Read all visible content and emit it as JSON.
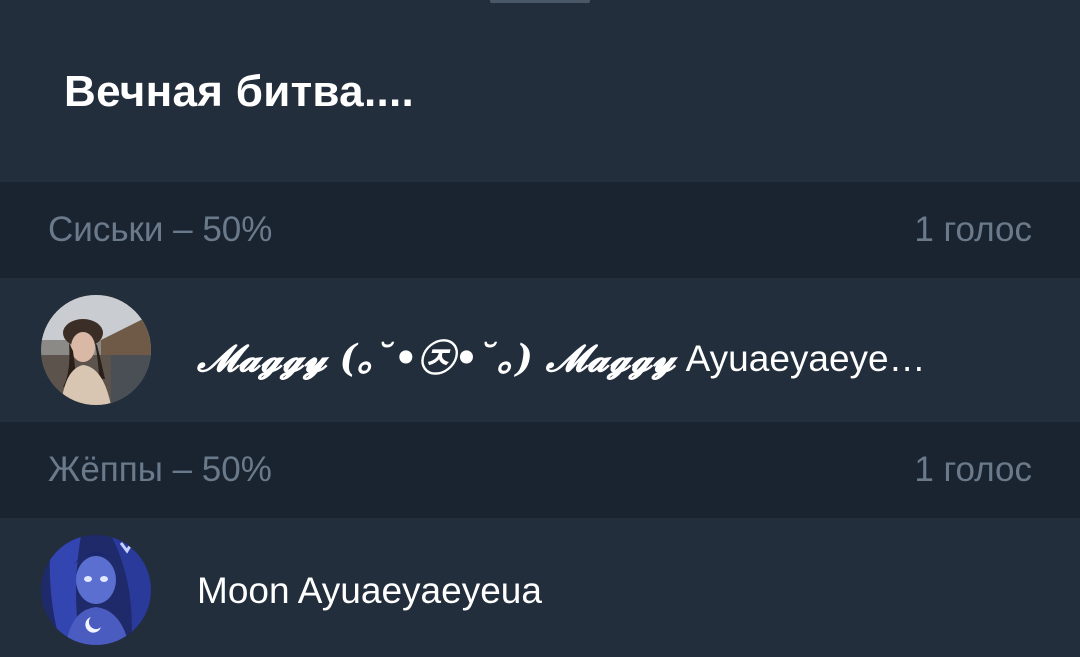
{
  "poll": {
    "title": "Вечная битва...."
  },
  "options": [
    {
      "label": "Сиськи – 50%",
      "votes": "1 голос",
      "voter": {
        "name_prefix": "𝓜𝓪𝓰𝓰𝔂 (｡˘•㉨•˘｡) 𝓜𝓪𝓰𝓰𝔂",
        "name_suffix": " Ayuaeyaeye…",
        "avatar": "user-photo-avatar"
      }
    },
    {
      "label": "Жёппы – 50%",
      "votes": "1 голос",
      "voter": {
        "name_prefix": "",
        "name_suffix": "Moon Ayuaeyaeyeua",
        "avatar": "anime-character-avatar"
      }
    }
  ],
  "colors": {
    "background": "#232e3c",
    "header_background": "#1a2431",
    "muted_text": "#6b7a8b",
    "primary_text": "#ffffff"
  }
}
